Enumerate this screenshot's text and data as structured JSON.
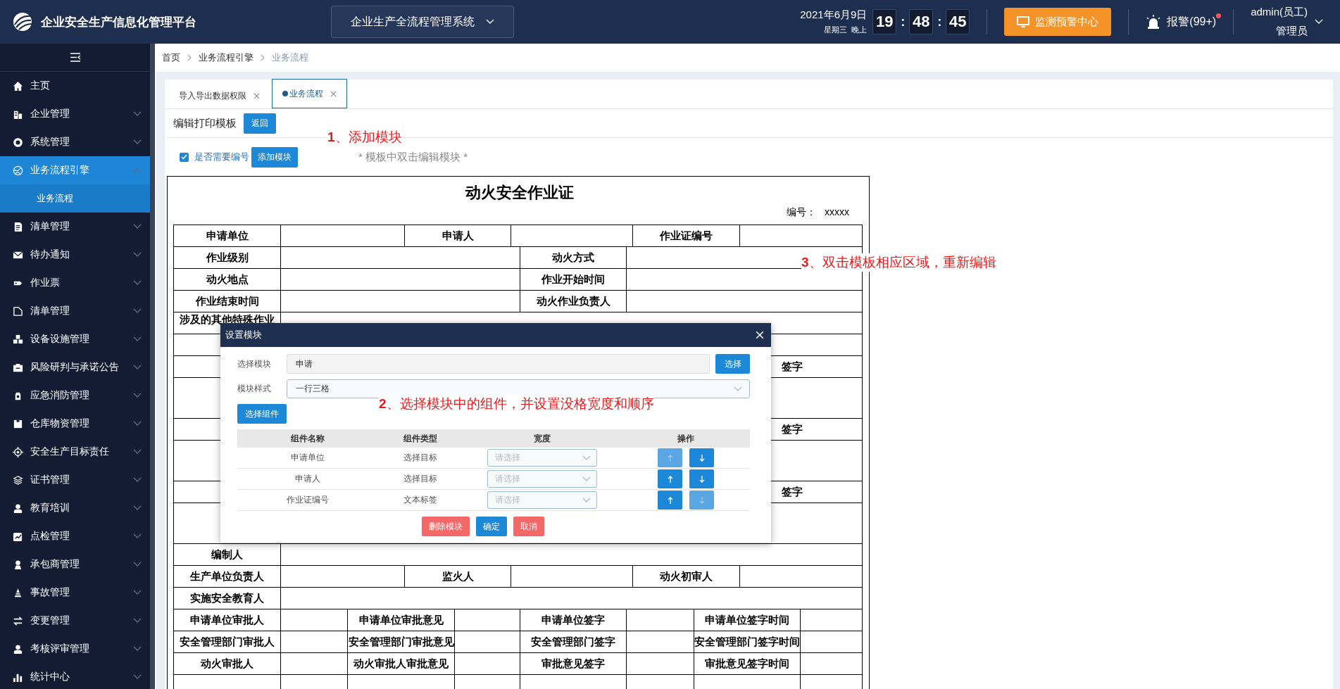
{
  "header": {
    "title": "企业安全生产信息化管理平台",
    "system_select": "企业生产全流程管理系统",
    "date": "2021年6月9日",
    "weekday": "星期三",
    "period": "晚上",
    "time": [
      "19",
      ":",
      "48",
      ":",
      "45"
    ],
    "monitor_button": "监测预警中心",
    "alarm": "报警(99+)",
    "alarm_unread": true,
    "user": "admin(员工)",
    "role": "管理员"
  },
  "sidebar": {
    "items": [
      {
        "label": "主页",
        "kind": "link",
        "selected": false
      },
      {
        "label": "企业管理",
        "kind": "group",
        "expanded": false,
        "selected": false
      },
      {
        "label": "系统管理",
        "kind": "group",
        "expanded": false,
        "selected": false
      },
      {
        "label": "业务流程引擎",
        "kind": "group",
        "expanded": true,
        "selected": true,
        "children": [
          {
            "label": "业务流程",
            "selected": true
          }
        ]
      },
      {
        "label": "清单管理",
        "kind": "group",
        "expanded": false,
        "selected": false
      },
      {
        "label": "待办通知",
        "kind": "group",
        "expanded": false,
        "selected": false
      },
      {
        "label": "作业票",
        "kind": "group",
        "expanded": false,
        "selected": false
      },
      {
        "label": "清单管理",
        "kind": "group",
        "expanded": false,
        "selected": false
      },
      {
        "label": "设备设施管理",
        "kind": "group",
        "expanded": false,
        "selected": false
      },
      {
        "label": "风险研判与承诺公告",
        "kind": "group",
        "expanded": false,
        "selected": false
      },
      {
        "label": "应急消防管理",
        "kind": "group",
        "expanded": false,
        "selected": false
      },
      {
        "label": "仓库物资管理",
        "kind": "group",
        "expanded": false,
        "selected": false
      },
      {
        "label": "安全生产目标责任",
        "kind": "group",
        "expanded": false,
        "selected": false
      },
      {
        "label": "证书管理",
        "kind": "group",
        "expanded": false,
        "selected": false
      },
      {
        "label": "教育培训",
        "kind": "group",
        "expanded": false,
        "selected": false
      },
      {
        "label": "点检管理",
        "kind": "group",
        "expanded": false,
        "selected": false
      },
      {
        "label": "承包商管理",
        "kind": "group",
        "expanded": false,
        "selected": false
      },
      {
        "label": "事故管理",
        "kind": "group",
        "expanded": false,
        "selected": false
      },
      {
        "label": "变更管理",
        "kind": "group",
        "expanded": false,
        "selected": false
      },
      {
        "label": "考核评审管理",
        "kind": "group",
        "expanded": false,
        "selected": false
      },
      {
        "label": "统计中心",
        "kind": "group",
        "expanded": false,
        "selected": false
      }
    ]
  },
  "breadcrumb": [
    "首页",
    "业务流程引擎",
    "业务流程"
  ],
  "tabs": [
    {
      "label": "导入导出数据权限",
      "selected": false
    },
    {
      "label": "业务流程",
      "selected": true
    }
  ],
  "toolbar": {
    "title": "编辑打印模板",
    "back_button": "返回"
  },
  "options": {
    "numbering_label": "是否需要编号",
    "numbering_checked": true,
    "add_button": "添加模块",
    "hint": "* 模板中双击编辑模块 *"
  },
  "annotations": [
    "**1**、添加模块",
    "**3**、双击模板相应区域，重新编辑"
  ],
  "form": {
    "title": "动火安全作业证",
    "number_label": "编号：",
    "number_value": "xxxxx",
    "rows": [
      {
        "kind": "three_pairs",
        "labels": [
          "申请单位",
          "申请人",
          "作业证编号"
        ]
      },
      {
        "kind": "two_pairs",
        "labels": [
          "作业级别",
          "动火方式"
        ]
      },
      {
        "kind": "two_pairs",
        "labels": [
          "动火地点",
          "作业开始时间"
        ]
      },
      {
        "kind": "two_pairs",
        "labels": [
          "作业结束时间",
          "动火作业负责人"
        ]
      },
      {
        "kind": "one_pair",
        "labels": [
          "涉及的其他特殊作业"
        ]
      },
      {
        "kind": "covered"
      },
      {
        "kind": "signature",
        "labels": [
          "签字"
        ]
      },
      {
        "kind": "blank"
      },
      {
        "kind": "signature",
        "labels": [
          "签字"
        ]
      },
      {
        "kind": "blank"
      },
      {
        "kind": "signature",
        "labels": [
          "签字"
        ]
      },
      {
        "kind": "blank"
      },
      {
        "kind": "one_pair",
        "labels": [
          "编制人"
        ]
      },
      {
        "kind": "three_pairs",
        "labels": [
          "生产单位负责人",
          "监火人",
          "动火初审人"
        ]
      },
      {
        "kind": "one_pair",
        "labels": [
          "实施安全教育人"
        ]
      },
      {
        "kind": "four_pairs",
        "labels": [
          "申请单位审批人",
          "申请单位审批意见",
          "申请单位签字",
          "申请单位签字时间"
        ]
      },
      {
        "kind": "four_pairs",
        "labels": [
          "安全管理部门审批人",
          "安全管理部门审批意见",
          "安全管理部门签字",
          "安全管理部门签字时间"
        ]
      },
      {
        "kind": "four_pairs",
        "labels": [
          "动火审批人",
          "动火审批人审批意见",
          "审批意见签字",
          "审批意见签字时间"
        ]
      },
      {
        "kind": "cut"
      }
    ]
  },
  "dialog": {
    "title": "设置模块",
    "module_label": "选择模块",
    "module_value": "申请",
    "choose_button": "选择",
    "style_label": "模块样式",
    "style_value": "一行三格",
    "components_button": "选择组件",
    "annotation": "**2**、选择模块中的组件，并设置没格宽度和顺序",
    "columns": [
      "组件名称",
      "组件类型",
      "宽度",
      "操作"
    ],
    "rows": [
      {
        "name": "申请单位",
        "type": "选择目标",
        "width_placeholder": "请选择",
        "up_disabled": true,
        "down_disabled": false
      },
      {
        "name": "申请人",
        "type": "选择目标",
        "width_placeholder": "请选择",
        "up_disabled": false,
        "down_disabled": false
      },
      {
        "name": "作业证编号",
        "type": "文本标签",
        "width_placeholder": "请选择",
        "up_disabled": false,
        "down_disabled": true
      }
    ],
    "buttons": [
      {
        "label": "删除模块",
        "kind": "danger"
      },
      {
        "label": "确定",
        "kind": "primary"
      },
      {
        "label": "取消",
        "kind": "danger"
      }
    ]
  }
}
